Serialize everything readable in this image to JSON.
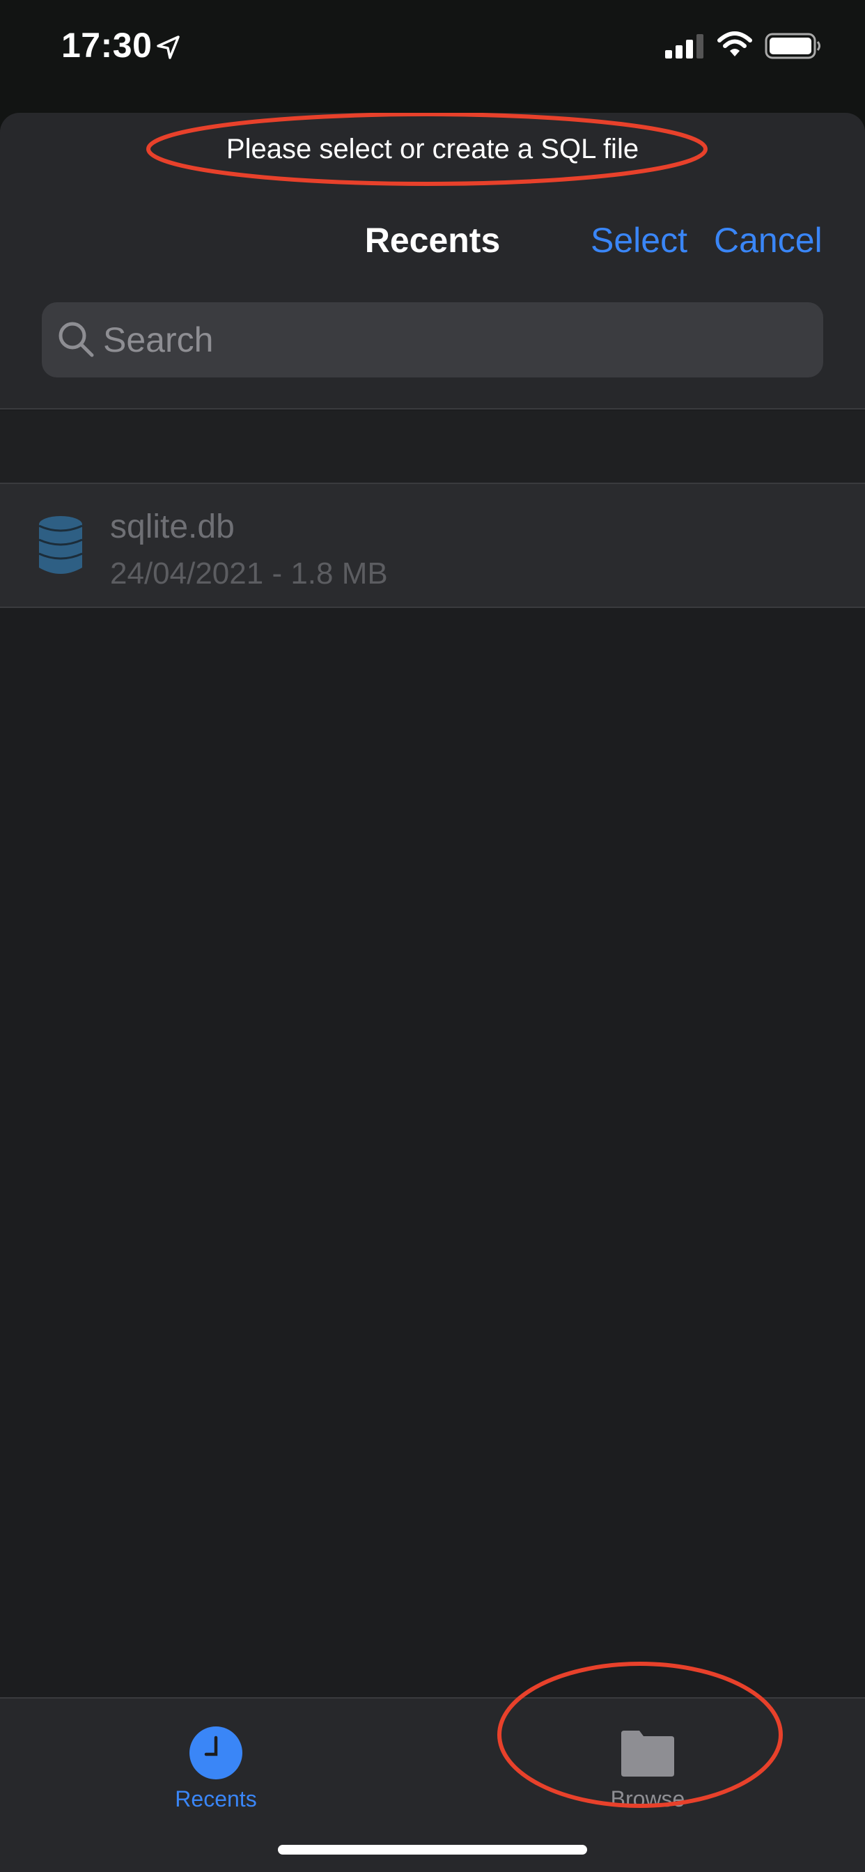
{
  "status_bar": {
    "time": "17:30",
    "icons": [
      "location-arrow-icon",
      "cellular-signal-icon",
      "wifi-icon",
      "battery-icon"
    ]
  },
  "sheet": {
    "prompt": "Please select or create a SQL file",
    "title": "Recents",
    "select_label": "Select",
    "cancel_label": "Cancel",
    "search": {
      "placeholder": "Search",
      "value": ""
    }
  },
  "files": [
    {
      "name": "sqlite.db",
      "meta": "24/04/2021 - 1.8 MB",
      "icon": "database-icon"
    }
  ],
  "tabs": [
    {
      "label": "Recents",
      "icon": "clock-icon",
      "selected": true
    },
    {
      "label": "Browse",
      "icon": "folder-icon",
      "selected": false
    }
  ],
  "colors": {
    "accent": "#3a86f7",
    "annotation": "#e8412b",
    "database_icon": "#2e5f84"
  }
}
